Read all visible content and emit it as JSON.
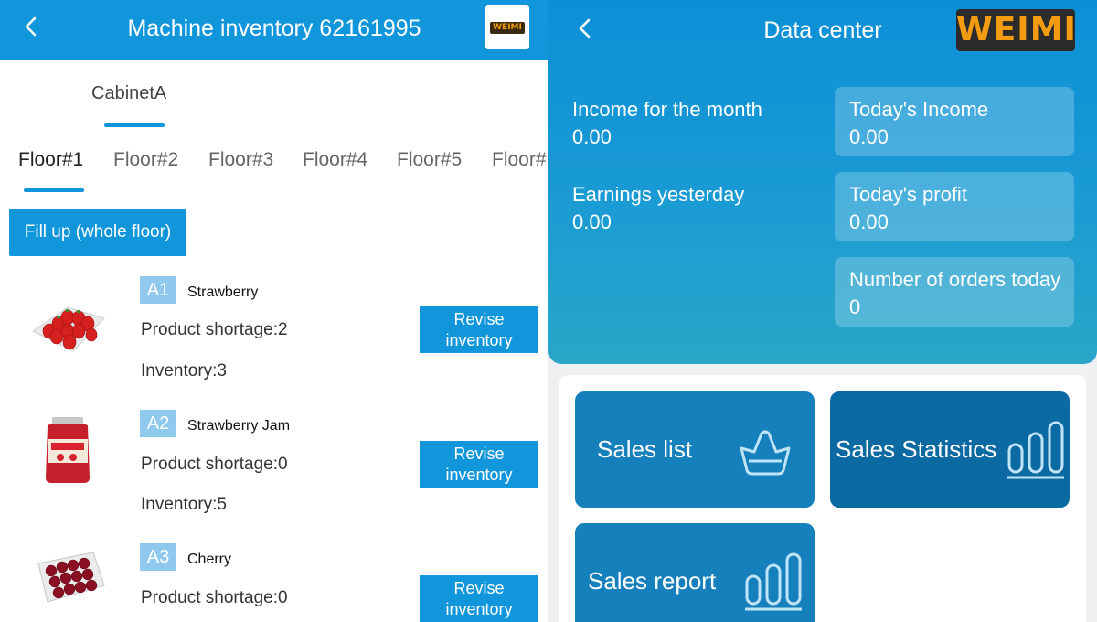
{
  "left": {
    "header": {
      "back_icon": "chevron-left-icon",
      "title": "Machine inventory 62161995",
      "logo_text": "WEIMI"
    },
    "cabinet_tab": "CabinetA",
    "floors": [
      "Floor#1",
      "Floor#2",
      "Floor#3",
      "Floor#4",
      "Floor#5",
      "Floor#"
    ],
    "active_floor": "Floor#1",
    "fill_button": "Fill up (whole floor)",
    "products": [
      {
        "slot": "A1",
        "name": "Strawberry",
        "shortage": "Product shortage:2",
        "inventory": "Inventory:3",
        "button": "Revise inventory",
        "image": "strawberry-tray"
      },
      {
        "slot": "A2",
        "name": "Strawberry Jam",
        "shortage": "Product shortage:0",
        "inventory": "Inventory:5",
        "button": "Revise inventory",
        "image": "jam-jar"
      },
      {
        "slot": "A3",
        "name": "Cherry",
        "shortage": "Product shortage:0",
        "inventory": "",
        "button": "Revise inventory",
        "image": "cherry-box"
      }
    ],
    "revise_line1": "Revise",
    "revise_line2": "inventory"
  },
  "right": {
    "header": {
      "back_icon": "chevron-left-icon",
      "title": "Data center",
      "logo_text": "WEIMI"
    },
    "stats": {
      "month_income": {
        "label": "Income for the month",
        "value": "0.00"
      },
      "yesterday": {
        "label": "Earnings yesterday",
        "value": "0.00"
      },
      "today_income": {
        "label": "Today's Income",
        "value": "0.00"
      },
      "today_profit": {
        "label": "Today's profit",
        "value": "0.00"
      },
      "orders_today": {
        "label": "Number of orders today",
        "value": "0"
      }
    },
    "menu": {
      "sales_list": {
        "label": "Sales list",
        "icon": "basket-icon"
      },
      "sales_statistics": {
        "label": "Sales Statistics",
        "icon": "bar-chart-icon"
      },
      "sales_report": {
        "label": "Sales report",
        "icon": "bar-chart-icon"
      }
    }
  },
  "colors": {
    "primary": "#1296db",
    "badge": "#8fc9ee",
    "logo_orange": "#f39c12"
  }
}
